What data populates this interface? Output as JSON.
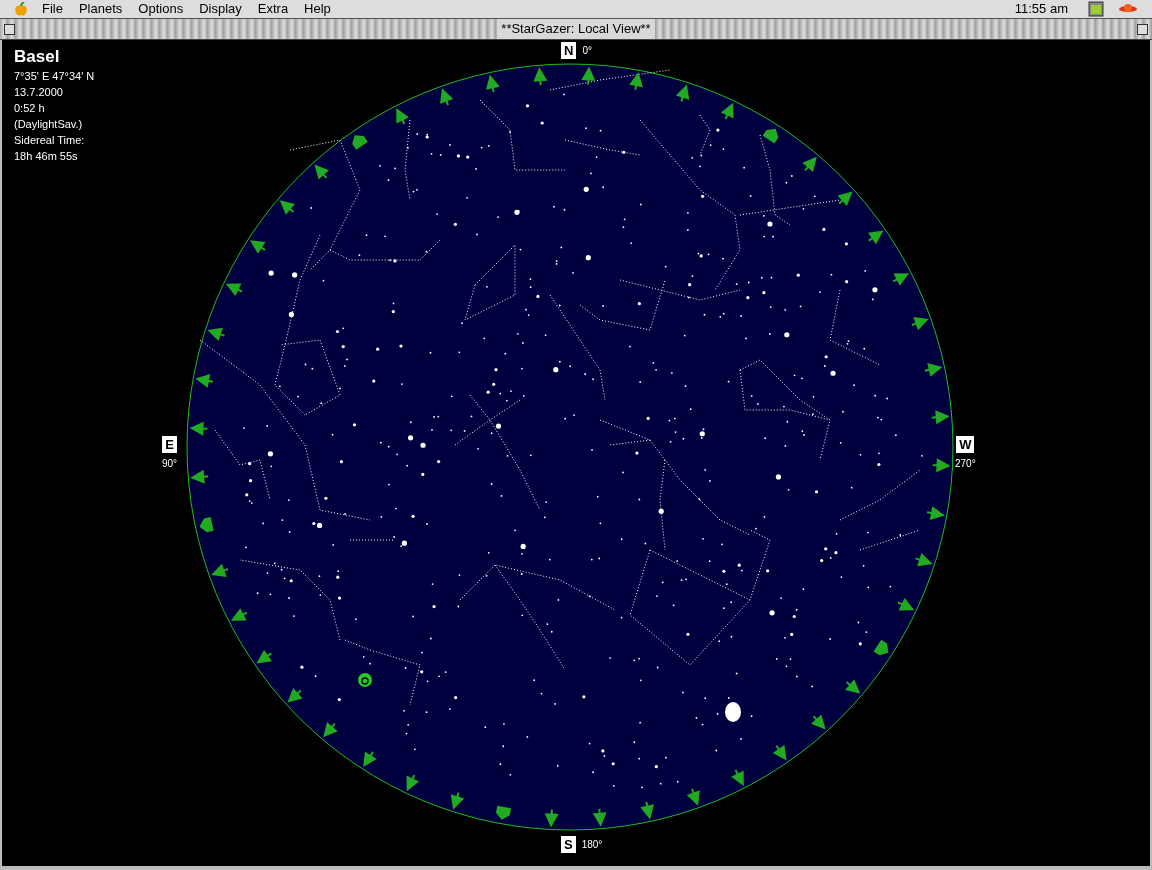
{
  "menu_bar": {
    "items": [
      "File",
      "Planets",
      "Options",
      "Display",
      "Extra",
      "Help"
    ],
    "clock": "11:55 am"
  },
  "window": {
    "title": "**StarGazer: Local View**"
  },
  "location": {
    "name": "Basel",
    "lines": [
      "7°35' E 47°34' N",
      "13.7.2000",
      "0:52 h",
      "(DaylightSav.)",
      "Sidereal Time:",
      "18h 46m 55s"
    ]
  },
  "compass": [
    {
      "kind": "top",
      "letter": "N",
      "degrees": "0°"
    },
    {
      "kind": "left",
      "letter": "E",
      "degrees": "90°"
    },
    {
      "kind": "right",
      "letter": "W",
      "degrees": "270°"
    },
    {
      "kind": "bottom",
      "letter": "S",
      "degrees": "180°"
    }
  ]
}
